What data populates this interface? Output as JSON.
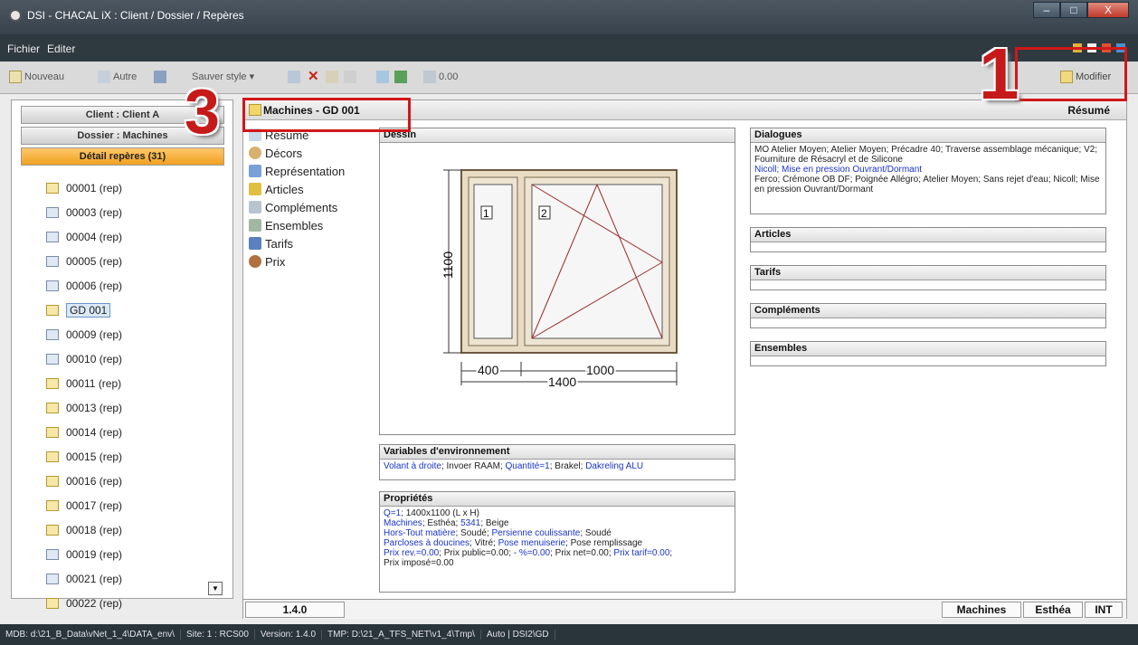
{
  "window": {
    "title": "DSI - CHACAL iX : Client / Dossier / Repères",
    "controls": [
      "–",
      "□",
      "X"
    ]
  },
  "menu": {
    "items": [
      "Fichier",
      "Editer"
    ]
  },
  "toolbar": {
    "nouveau": "Nouveau",
    "autre": "Autre",
    "style": "Sauver style ▾",
    "value": "0.00",
    "modifier": "Modifier"
  },
  "annotations": {
    "one": "1",
    "three": "3"
  },
  "left": {
    "client_btn": "Client : Client A",
    "dossier_btn": "Dossier : Machines",
    "detail_btn": "Détail repères (31)",
    "reps": [
      {
        "label": "00001 (rep)",
        "icon": "yellow-doc-icon"
      },
      {
        "label": "00003 (rep)",
        "icon": "blue-doc-icon"
      },
      {
        "label": "00004 (rep)",
        "icon": "blue-doc-icon"
      },
      {
        "label": "00005 (rep)",
        "icon": "blue-doc-icon"
      },
      {
        "label": "00006 (rep)",
        "icon": "blue-doc-icon"
      },
      {
        "label": "GD 001",
        "icon": "yellow-doc-icon"
      },
      {
        "label": "00009 (rep)",
        "icon": "blue-doc-icon"
      },
      {
        "label": "00010 (rep)",
        "icon": "blue-doc-icon"
      },
      {
        "label": "00011 (rep)",
        "icon": "yellow-doc-icon"
      },
      {
        "label": "00013 (rep)",
        "icon": "yellow-doc-icon"
      },
      {
        "label": "00014 (rep)",
        "icon": "yellow-doc-icon"
      },
      {
        "label": "00015 (rep)",
        "icon": "yellow-doc-icon"
      },
      {
        "label": "00016 (rep)",
        "icon": "yellow-doc-icon"
      },
      {
        "label": "00017 (rep)",
        "icon": "yellow-doc-icon"
      },
      {
        "label": "00018 (rep)",
        "icon": "yellow-doc-icon"
      },
      {
        "label": "00019 (rep)",
        "icon": "blue-doc-icon"
      },
      {
        "label": "00021 (rep)",
        "icon": "blue-doc-icon"
      },
      {
        "label": "00022 (rep)",
        "icon": "yellow-doc-icon"
      }
    ]
  },
  "main": {
    "title": "Machines - GD 001",
    "right_title": "Résumé",
    "nav": [
      "Résumé",
      "Décors",
      "Représentation",
      "Articles",
      "Compléments",
      "Ensembles",
      "Tarifs",
      "Prix"
    ],
    "dessin": {
      "title": "Dessin",
      "height": "1100",
      "w1": "400",
      "w2": "1000",
      "total": "1400",
      "pane1": "1",
      "pane2": "2"
    },
    "vars": {
      "title": "Variables d'environnement",
      "parts": [
        {
          "t": "Volant à droite",
          "b": true
        },
        {
          "t": "; Invoer RAAM; ",
          "b": false
        },
        {
          "t": "Quantité=1",
          "b": true
        },
        {
          "t": "; Brakel; ",
          "b": false
        },
        {
          "t": "Dakreling ALU",
          "b": true
        }
      ]
    },
    "props": {
      "title": "Propriétés",
      "lines": [
        [
          {
            "t": "Q=1",
            "b": true
          },
          {
            "t": "; 1400x1100 (L x H)",
            "b": false
          }
        ],
        [
          {
            "t": "Machines",
            "b": true
          },
          {
            "t": "; Esthéa; ",
            "b": false
          },
          {
            "t": "5341",
            "b": true
          },
          {
            "t": "; Beige",
            "b": false
          }
        ],
        [
          {
            "t": "Hors-Tout matière",
            "b": true
          },
          {
            "t": "; Soudé; ",
            "b": false
          },
          {
            "t": "Persienne coulissante",
            "b": true
          },
          {
            "t": "; Soudé",
            "b": false
          }
        ],
        [
          {
            "t": "Parcloses à doucines",
            "b": true
          },
          {
            "t": "; Vitré; ",
            "b": false
          },
          {
            "t": "Pose menuiserie",
            "b": true
          },
          {
            "t": "; Pose remplissage",
            "b": false
          }
        ],
        [
          {
            "t": "Prix rev.=0.00",
            "b": true
          },
          {
            "t": "; Prix public=0.00; ",
            "b": false
          },
          {
            "t": "- %=0.00",
            "b": true
          },
          {
            "t": "; Prix net=0.00; ",
            "b": false
          },
          {
            "t": "Prix tarif=0.00",
            "b": true
          },
          {
            "t": ";",
            "b": false
          }
        ],
        [
          {
            "t": "Prix imposé=0.00",
            "b": false
          }
        ]
      ]
    },
    "dialogues": {
      "title": "Dialogues",
      "lines": [
        {
          "t": "MO Atelier Moyen; Atelier Moyen; Précadre 40; Traverse assemblage mécanique; V2; Fourniture de Résacryl et de Silicone",
          "b": false
        },
        {
          "t": "Nicoll; Mise en pression Ouvrant/Dormant",
          "b": true
        },
        {
          "t": "Ferco; Crémone OB DF; Poignée Allégro; Atelier Moyen; Sans rejet d'eau; Nicoll; Mise en pression Ouvrant/Dormant",
          "b": false
        }
      ]
    },
    "articles": "Articles",
    "tarifs": "Tarifs",
    "complements": "Compléments",
    "ensembles": "Ensembles",
    "version": "1.4.0",
    "tabs": [
      "Machines",
      "Esthéa",
      "INT"
    ]
  },
  "status": [
    "MDB: d:\\21_B_Data\\vNet_1_4\\DATA_env\\",
    "Site: 1 : RCS00",
    "Version: 1.4.0",
    "TMP: D:\\21_A_TFS_NET\\v1_4\\Tmp\\",
    "Auto | DSI2\\GD"
  ]
}
